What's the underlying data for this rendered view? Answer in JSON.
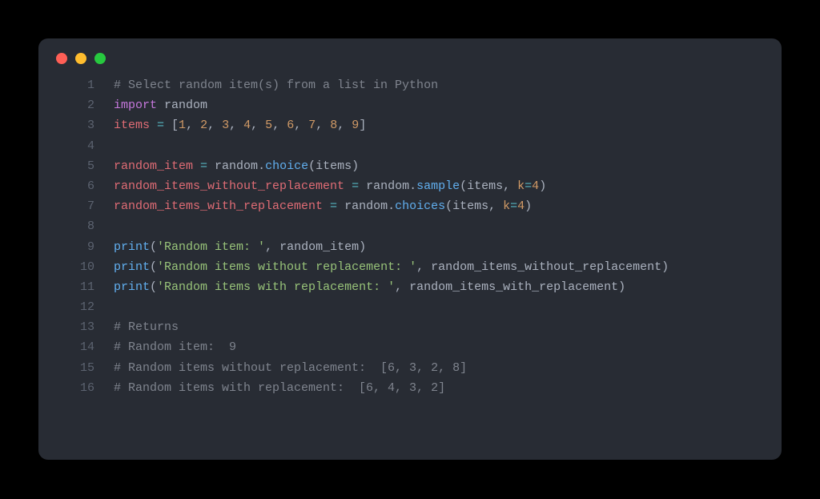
{
  "window": {
    "buttons": {
      "close": "close",
      "min": "minimize",
      "max": "maximize"
    }
  },
  "syntax_colors": {
    "comment": "#7f848e",
    "keyword": "#c678dd",
    "identifier": "#e06c75",
    "operator": "#56b6c2",
    "number": "#d19a66",
    "function": "#61afef",
    "string": "#98c379",
    "default": "#abb2bf"
  },
  "lines": [
    {
      "n": "1",
      "tokens": [
        {
          "t": "# Select random item(s) from a list in Python",
          "c": "comment"
        }
      ]
    },
    {
      "n": "2",
      "tokens": [
        {
          "t": "import",
          "c": "import"
        },
        {
          "t": " ",
          "c": "default"
        },
        {
          "t": "random",
          "c": "module"
        }
      ]
    },
    {
      "n": "3",
      "tokens": [
        {
          "t": "items ",
          "c": "ident"
        },
        {
          "t": "=",
          "c": "op"
        },
        {
          "t": " [",
          "c": "punct"
        },
        {
          "t": "1",
          "c": "num"
        },
        {
          "t": ", ",
          "c": "punct"
        },
        {
          "t": "2",
          "c": "num"
        },
        {
          "t": ", ",
          "c": "punct"
        },
        {
          "t": "3",
          "c": "num"
        },
        {
          "t": ", ",
          "c": "punct"
        },
        {
          "t": "4",
          "c": "num"
        },
        {
          "t": ", ",
          "c": "punct"
        },
        {
          "t": "5",
          "c": "num"
        },
        {
          "t": ", ",
          "c": "punct"
        },
        {
          "t": "6",
          "c": "num"
        },
        {
          "t": ", ",
          "c": "punct"
        },
        {
          "t": "7",
          "c": "num"
        },
        {
          "t": ", ",
          "c": "punct"
        },
        {
          "t": "8",
          "c": "num"
        },
        {
          "t": ", ",
          "c": "punct"
        },
        {
          "t": "9",
          "c": "num"
        },
        {
          "t": "]",
          "c": "punct"
        }
      ]
    },
    {
      "n": "4",
      "tokens": [
        {
          "t": "",
          "c": "default"
        }
      ]
    },
    {
      "n": "5",
      "tokens": [
        {
          "t": "random_item ",
          "c": "ident"
        },
        {
          "t": "=",
          "c": "op"
        },
        {
          "t": " random",
          "c": "default"
        },
        {
          "t": ".",
          "c": "punct"
        },
        {
          "t": "choice",
          "c": "attr"
        },
        {
          "t": "(items)",
          "c": "punct"
        }
      ]
    },
    {
      "n": "6",
      "tokens": [
        {
          "t": "random_items_without_replacement ",
          "c": "ident"
        },
        {
          "t": "=",
          "c": "op"
        },
        {
          "t": " random",
          "c": "default"
        },
        {
          "t": ".",
          "c": "punct"
        },
        {
          "t": "sample",
          "c": "attr"
        },
        {
          "t": "(items, ",
          "c": "punct"
        },
        {
          "t": "k",
          "c": "kwarg"
        },
        {
          "t": "=",
          "c": "op"
        },
        {
          "t": "4",
          "c": "num"
        },
        {
          "t": ")",
          "c": "punct"
        }
      ]
    },
    {
      "n": "7",
      "tokens": [
        {
          "t": "random_items_with_replacement ",
          "c": "ident"
        },
        {
          "t": "=",
          "c": "op"
        },
        {
          "t": " random",
          "c": "default"
        },
        {
          "t": ".",
          "c": "punct"
        },
        {
          "t": "choices",
          "c": "attr"
        },
        {
          "t": "(items, ",
          "c": "punct"
        },
        {
          "t": "k",
          "c": "kwarg"
        },
        {
          "t": "=",
          "c": "op"
        },
        {
          "t": "4",
          "c": "num"
        },
        {
          "t": ")",
          "c": "punct"
        }
      ]
    },
    {
      "n": "8",
      "tokens": [
        {
          "t": "",
          "c": "default"
        }
      ]
    },
    {
      "n": "9",
      "tokens": [
        {
          "t": "print",
          "c": "func"
        },
        {
          "t": "(",
          "c": "punct"
        },
        {
          "t": "'Random item: '",
          "c": "str"
        },
        {
          "t": ", random_item)",
          "c": "punct"
        }
      ]
    },
    {
      "n": "10",
      "tokens": [
        {
          "t": "print",
          "c": "func"
        },
        {
          "t": "(",
          "c": "punct"
        },
        {
          "t": "'Random items without replacement: '",
          "c": "str"
        },
        {
          "t": ", random_items_without_replacement)",
          "c": "punct"
        }
      ]
    },
    {
      "n": "11",
      "tokens": [
        {
          "t": "print",
          "c": "func"
        },
        {
          "t": "(",
          "c": "punct"
        },
        {
          "t": "'Random items with replacement: '",
          "c": "str"
        },
        {
          "t": ", random_items_with_replacement)",
          "c": "punct"
        }
      ]
    },
    {
      "n": "12",
      "tokens": [
        {
          "t": "",
          "c": "default"
        }
      ]
    },
    {
      "n": "13",
      "tokens": [
        {
          "t": "# Returns",
          "c": "comment"
        }
      ]
    },
    {
      "n": "14",
      "tokens": [
        {
          "t": "# Random item:  9",
          "c": "comment"
        }
      ]
    },
    {
      "n": "15",
      "tokens": [
        {
          "t": "# Random items without replacement:  [6, 3, 2, 8]",
          "c": "comment"
        }
      ]
    },
    {
      "n": "16",
      "tokens": [
        {
          "t": "# Random items with replacement:  [6, 4, 3, 2]",
          "c": "comment"
        }
      ]
    }
  ]
}
